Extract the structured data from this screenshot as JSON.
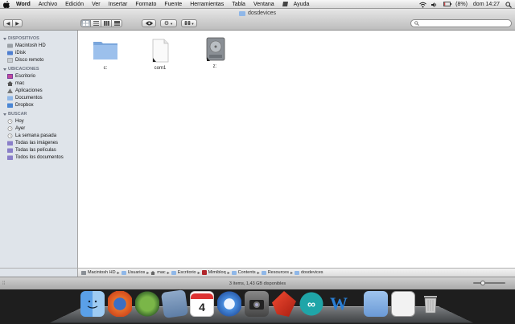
{
  "menubar": {
    "app_name": "Word",
    "items": [
      "Archivo",
      "Edición",
      "Ver",
      "Insertar",
      "Formato",
      "Fuente",
      "Herramientas",
      "Tabla",
      "Ventana"
    ],
    "help_label": "Ayuda",
    "battery": "(8%)",
    "clock": "dom 14:27"
  },
  "window": {
    "title": "dosdevices"
  },
  "search": {
    "placeholder": ""
  },
  "sidebar": {
    "sections": [
      {
        "title": "DISPOSITIVOS",
        "items": [
          {
            "label": "Macintosh HD",
            "icon": "harddisk-icon"
          },
          {
            "label": "iDisk",
            "icon": "idisk-icon"
          },
          {
            "label": "Disco remoto",
            "icon": "remote-disc-icon"
          }
        ]
      },
      {
        "title": "UBICACIONES",
        "items": [
          {
            "label": "Escritorio",
            "icon": "desktop-icon"
          },
          {
            "label": "mac",
            "icon": "home-icon"
          },
          {
            "label": "Aplicaciones",
            "icon": "applications-icon"
          },
          {
            "label": "Documentos",
            "icon": "documents-icon"
          },
          {
            "label": "Dropbox",
            "icon": "dropbox-icon"
          }
        ]
      },
      {
        "title": "BUSCAR",
        "items": [
          {
            "label": "Hoy",
            "icon": "clock-icon"
          },
          {
            "label": "Ayer",
            "icon": "clock-icon"
          },
          {
            "label": "La semana pasada",
            "icon": "clock-icon"
          },
          {
            "label": "Todas las imágenes",
            "icon": "smart-folder-icon"
          },
          {
            "label": "Todas las películas",
            "icon": "smart-folder-icon"
          },
          {
            "label": "Todos los documentos",
            "icon": "smart-folder-icon"
          }
        ]
      }
    ]
  },
  "files": [
    {
      "name": "c:",
      "kind": "folder"
    },
    {
      "name": "com1",
      "kind": "document"
    },
    {
      "name": "z:",
      "kind": "drive"
    }
  ],
  "pathbar": [
    "Macintosh HD",
    "Usuarios",
    "mac",
    "Escritorio",
    "Mimibloq",
    "Contents",
    "Resources",
    "dosdevices"
  ],
  "status": {
    "text": "3 ítems, 1,43 GB disponibles"
  },
  "colors": {
    "sidebar_bg": "#dfe4ea",
    "folder_blue": "#8fb7e8",
    "dock_bg": "#1e1e1e"
  }
}
